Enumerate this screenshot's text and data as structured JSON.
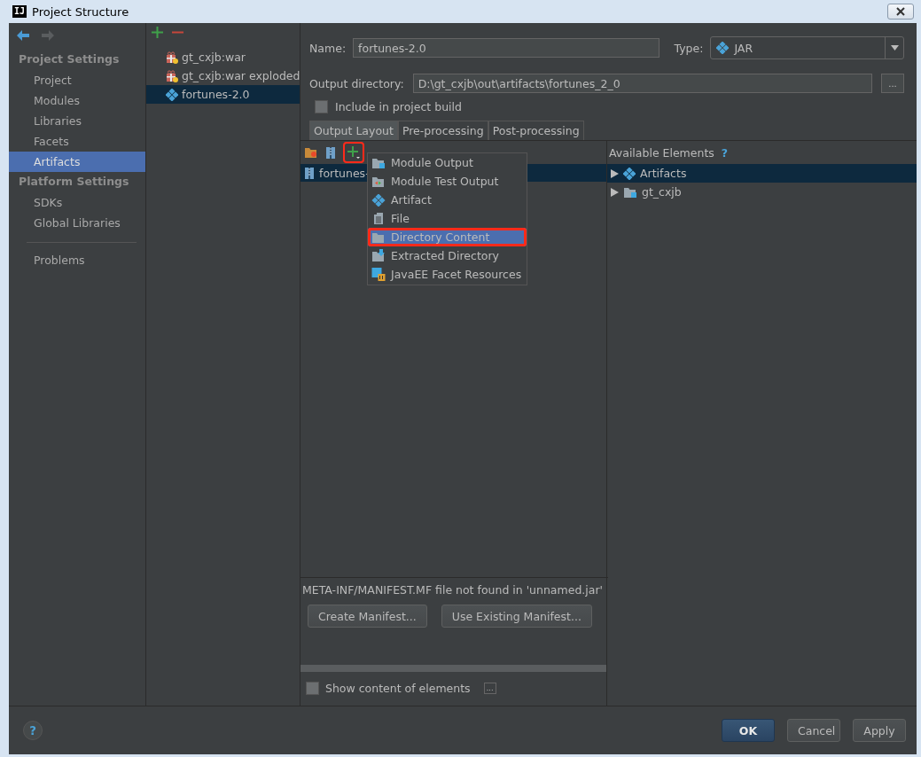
{
  "window": {
    "logo": "IJ",
    "title": "Project Structure"
  },
  "sidebar": {
    "sections": [
      {
        "title": "Project Settings",
        "items": [
          {
            "label": "Project",
            "selected": false
          },
          {
            "label": "Modules",
            "selected": false
          },
          {
            "label": "Libraries",
            "selected": false
          },
          {
            "label": "Facets",
            "selected": false
          },
          {
            "label": "Artifacts",
            "selected": true
          }
        ]
      },
      {
        "title": "Platform Settings",
        "items": [
          {
            "label": "SDKs",
            "selected": false
          },
          {
            "label": "Global Libraries",
            "selected": false
          }
        ]
      }
    ],
    "footer_items": [
      {
        "label": "Problems",
        "selected": false
      }
    ]
  },
  "artifacts": [
    {
      "label": "gt_cxjb:war",
      "kind": "war",
      "selected": false
    },
    {
      "label": "gt_cxjb:war exploded",
      "kind": "war",
      "selected": false
    },
    {
      "label": "fortunes-2.0",
      "kind": "jar",
      "selected": true
    }
  ],
  "form": {
    "name_label": "Name:",
    "name": "fortunes-2.0",
    "type_label": "Type:",
    "type": "JAR",
    "output_label": "Output directory:",
    "output": "D:\\gt_cxjb\\out\\artifacts\\fortunes_2_0",
    "browse": "...",
    "include_label": "Include in project build",
    "include_checked": false
  },
  "tabs": [
    {
      "label": "Output Layout",
      "selected": true
    },
    {
      "label": "Pre-processing",
      "selected": false
    },
    {
      "label": "Post-processing",
      "selected": false
    }
  ],
  "toolbar": {
    "add_highlighted": true
  },
  "layout_tree": [
    {
      "label": "fortunes-",
      "selected": true
    }
  ],
  "available": {
    "title": "Available Elements",
    "help": "?",
    "items": [
      {
        "label": "Artifacts",
        "kind": "artifact",
        "selected": true
      },
      {
        "label": "gt_cxjb",
        "kind": "module",
        "selected": false
      }
    ]
  },
  "add_menu": {
    "items": [
      {
        "label": "Module Output",
        "kind": "module",
        "selected": false,
        "highlighted": false
      },
      {
        "label": "Module Test Output",
        "kind": "test",
        "selected": false,
        "highlighted": false
      },
      {
        "label": "Artifact",
        "kind": "artifact",
        "selected": false,
        "highlighted": false
      },
      {
        "label": "File",
        "kind": "file",
        "selected": false,
        "highlighted": false
      },
      {
        "label": "Directory Content",
        "kind": "folder",
        "selected": true,
        "highlighted": true
      },
      {
        "label": "Extracted Directory",
        "kind": "extract",
        "selected": false,
        "highlighted": false
      },
      {
        "label": "JavaEE Facet Resources",
        "kind": "javaee",
        "selected": false,
        "highlighted": false
      }
    ]
  },
  "manifest": {
    "message": "META-INF/MANIFEST.MF file not found in 'unnamed.jar'",
    "buttons": [
      "Create Manifest...",
      "Use Existing Manifest..."
    ]
  },
  "show_content": {
    "label": "Show content of elements",
    "checked": false,
    "more": "..."
  },
  "footer": {
    "help": "?",
    "buttons": [
      {
        "label": "OK",
        "kind": "default"
      },
      {
        "label": "Cancel",
        "kind": "normal"
      },
      {
        "label": "Apply",
        "kind": "normal"
      }
    ]
  }
}
